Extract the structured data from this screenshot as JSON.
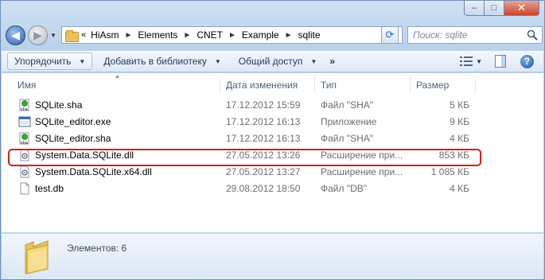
{
  "window": {
    "caption_buttons": {
      "minimize": "–",
      "maximize": "□",
      "close": "✕"
    }
  },
  "nav": {
    "back_icon": "arrow-left-icon",
    "forward_icon": "arrow-right-icon"
  },
  "address": {
    "lead": "«",
    "crumbs": [
      "HiAsm",
      "Elements",
      "CNET",
      "Example",
      "sqlite"
    ],
    "separator": "►"
  },
  "search": {
    "placeholder": "Поиск: sqlite"
  },
  "toolbar": {
    "organize": "Упорядочить",
    "add_library": "Добавить в библиотеку",
    "share": "Общий доступ",
    "more": "»"
  },
  "columns": {
    "name": "Имя",
    "date": "Дата изменения",
    "type": "Тип",
    "size": "Размер"
  },
  "files": [
    {
      "name": "SQLite.sha",
      "date": "17.12.2012 15:59",
      "type": "Файл \"SHA\"",
      "size": "5 КБ",
      "icon": "sha-file-icon"
    },
    {
      "name": "SQLite_editor.exe",
      "date": "17.12.2012 16:13",
      "type": "Приложение",
      "size": "9 КБ",
      "icon": "exe-file-icon"
    },
    {
      "name": "SQLite_editor.sha",
      "date": "17.12.2012 16:13",
      "type": "Файл \"SHA\"",
      "size": "4 КБ",
      "icon": "sha-file-icon"
    },
    {
      "name": "System.Data.SQLite.dll",
      "date": "27.05.2012 13:26",
      "type": "Расширение при...",
      "size": "853 КБ",
      "icon": "dll-file-icon"
    },
    {
      "name": "System.Data.SQLite.x64.dll",
      "date": "27.05.2012 13:27",
      "type": "Расширение при...",
      "size": "1 085 КБ",
      "icon": "dll-file-icon"
    },
    {
      "name": "test.db",
      "date": "29.08.2012 18:50",
      "type": "Файл \"DB\"",
      "size": "4 КБ",
      "icon": "db-file-icon"
    }
  ],
  "details": {
    "count_text": "Элементов: 6"
  },
  "colors": {
    "highlight": "#d81d1d",
    "toolbar_text": "#1e395b"
  }
}
